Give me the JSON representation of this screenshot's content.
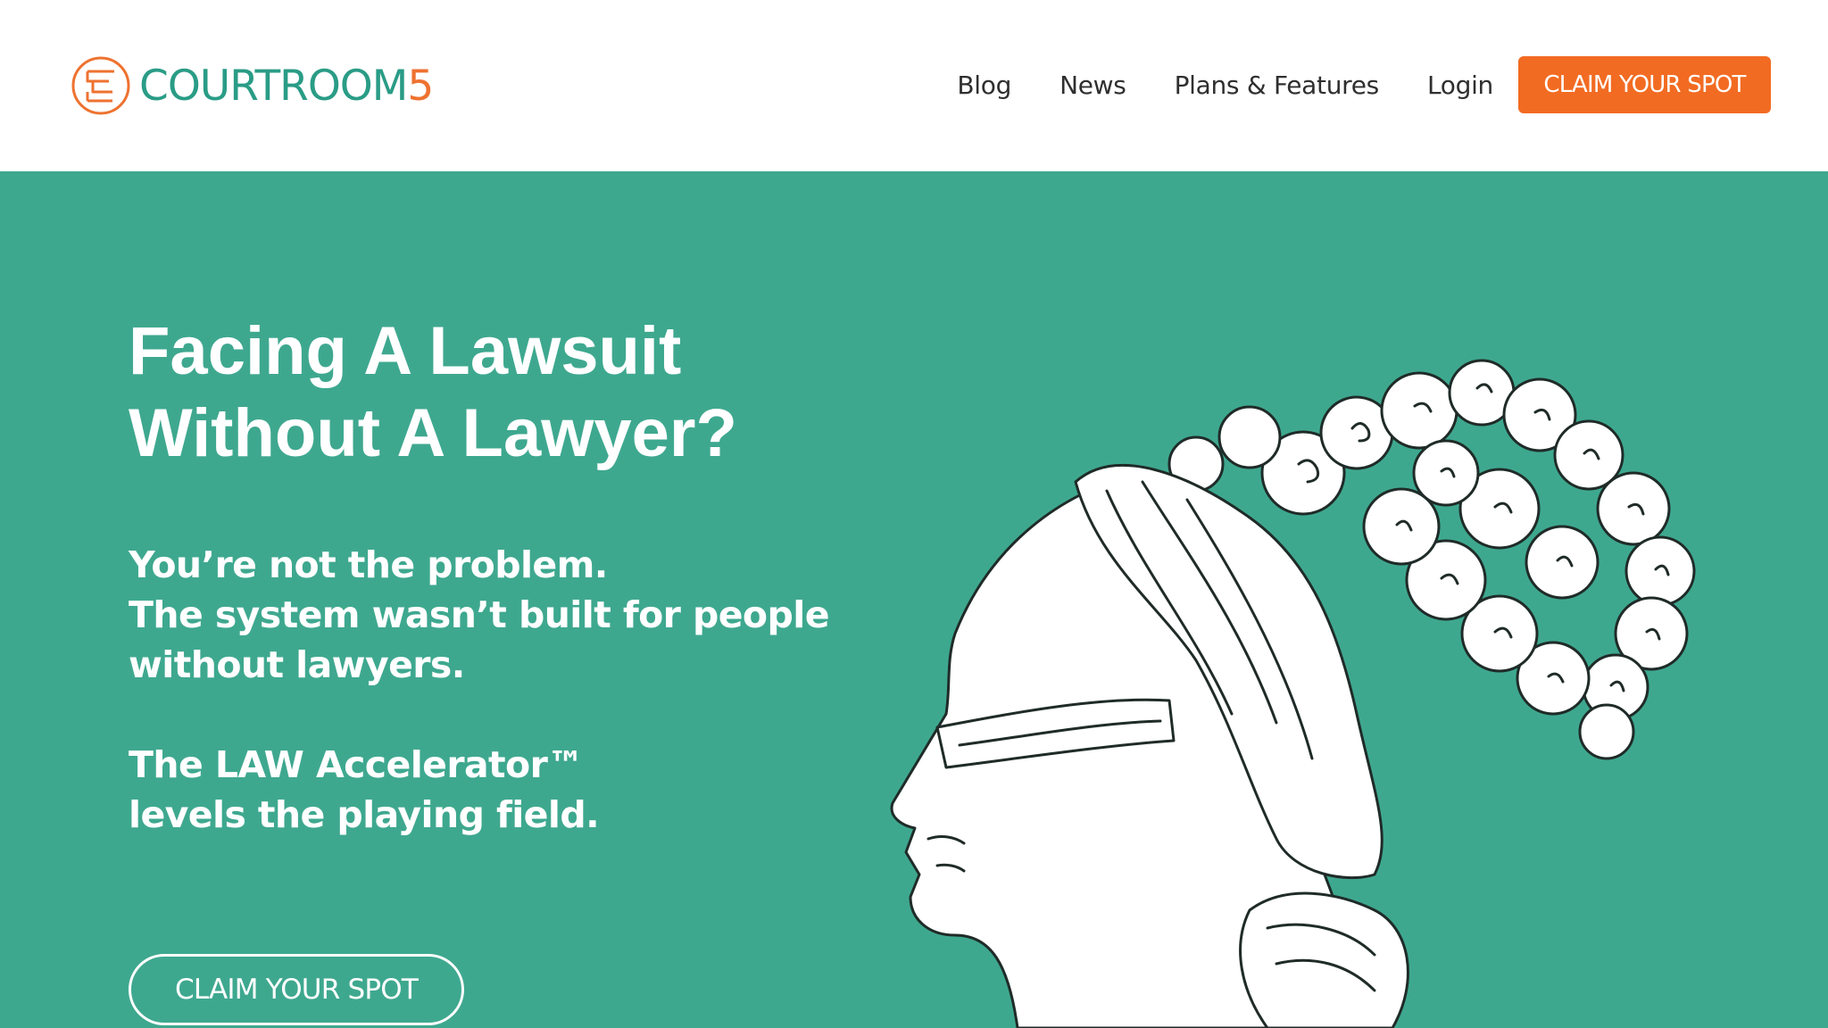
{
  "header": {
    "logo": {
      "word": "COURTROOM",
      "number": "5",
      "icon": "courtroom5-logo-icon"
    },
    "nav": {
      "items": [
        "Blog",
        "News",
        "Plans & Features",
        "Login"
      ],
      "cta_label": "CLAIM YOUR SPOT"
    }
  },
  "hero": {
    "title_lines": [
      "Facing A Lawsuit",
      "Without A Lawyer?"
    ],
    "body_lines": [
      "You’re not the problem.",
      "The system wasn’t built for people",
      "without lawyers.",
      "The LAW Accelerator™",
      "levels the playing field."
    ],
    "cta_label": "CLAIM YOUR SPOT",
    "illustration": "blindfolded-woman-line-drawing"
  },
  "colors": {
    "brand_green": "#3ea88f",
    "logo_green": "#2a9c86",
    "accent_orange": "#f26b22",
    "white": "#ffffff",
    "nav_text": "#2f2f2f"
  }
}
